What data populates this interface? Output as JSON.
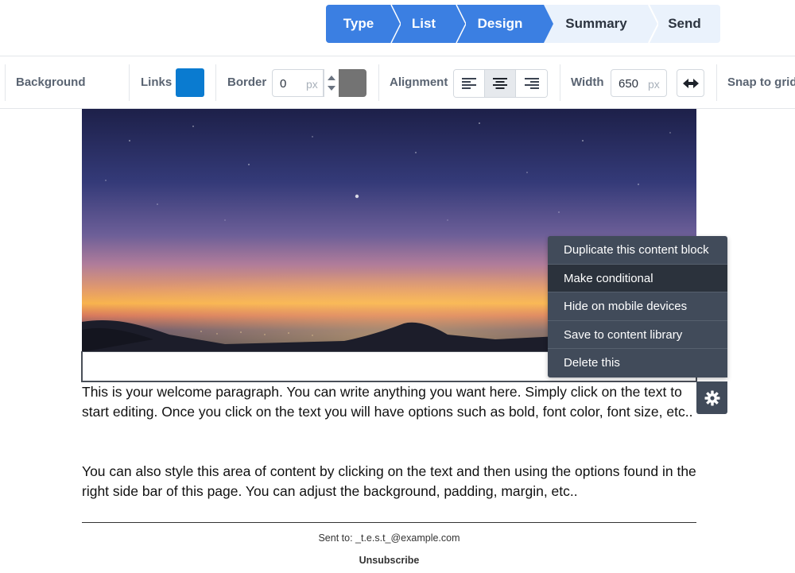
{
  "wizard": {
    "steps": [
      {
        "label": "Type",
        "state": "done"
      },
      {
        "label": "List",
        "state": "done"
      },
      {
        "label": "Design",
        "state": "current"
      },
      {
        "label": "Summary",
        "state": "todo"
      },
      {
        "label": "Send",
        "state": "todo"
      }
    ]
  },
  "toolbar": {
    "background_label": "Background",
    "links_label": "Links",
    "links_color": "#0a7bd0",
    "border_label": "Border",
    "border_value": "0",
    "border_unit": "px",
    "border_color": "#737373",
    "alignment_label": "Alignment",
    "alignment_selected": "center",
    "width_label": "Width",
    "width_value": "650",
    "width_unit": "px",
    "snap_label": "Snap to grid"
  },
  "context_menu": {
    "items": [
      {
        "label": "Duplicate this content block"
      },
      {
        "label": "Make conditional"
      },
      {
        "label": "Hide on mobile devices"
      },
      {
        "label": "Save to content library"
      },
      {
        "label": "Delete this"
      }
    ],
    "hovered_index": 1
  },
  "content": {
    "paragraph1": "This is your welcome paragraph. You can write anything you want here. Simply click on the text to start editing. Once you click on the text you will have options such as bold, font color, font size, etc..",
    "paragraph2": "You can also style this area of content by clicking on the text and then using the options found in the right side bar of this page. You can adjust the background, padding, margin, etc..",
    "sent_to": "Sent to: _t.e.s.t_@example.com",
    "unsubscribe": "Unsubscribe"
  },
  "colors": {
    "accent": "#3b7fe2",
    "step_inactive": "#eaf2fc",
    "menu_bg": "#414b5a",
    "menu_hover": "#2b323c"
  }
}
